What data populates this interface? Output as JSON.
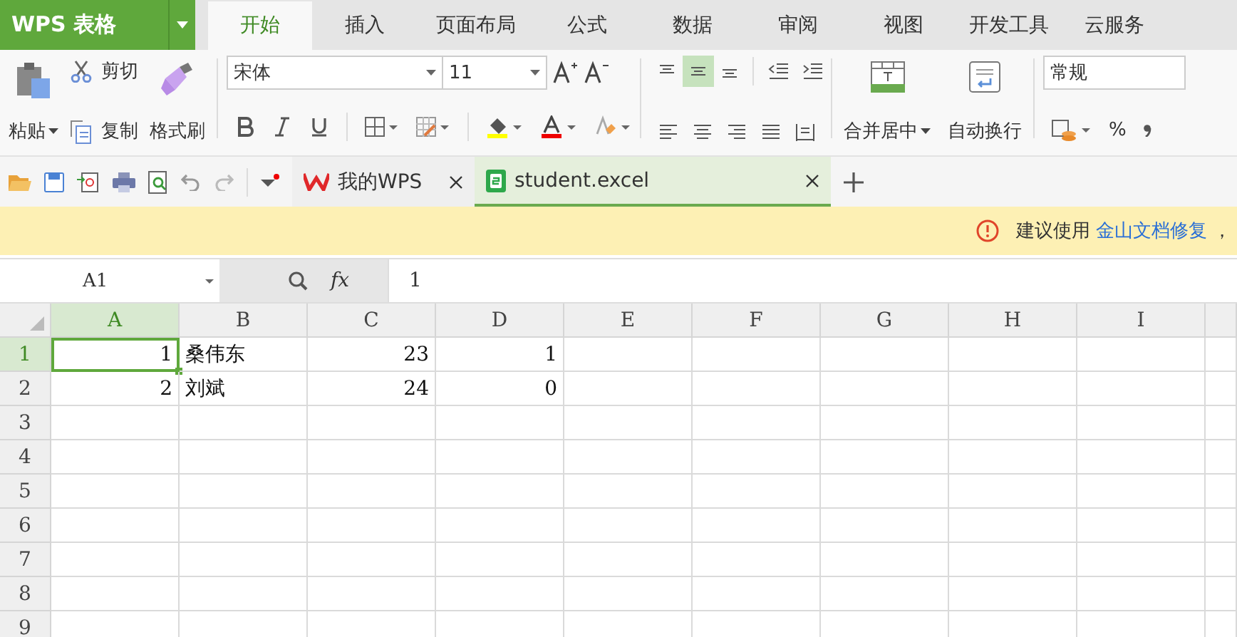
{
  "app": {
    "name": "WPS 表格"
  },
  "menu_tabs": [
    {
      "label": "开始",
      "selected": true
    },
    {
      "label": "插入",
      "selected": false
    },
    {
      "label": "页面布局",
      "selected": false
    },
    {
      "label": "公式",
      "selected": false
    },
    {
      "label": "数据",
      "selected": false
    },
    {
      "label": "审阅",
      "selected": false
    },
    {
      "label": "视图",
      "selected": false
    },
    {
      "label": "开发工具",
      "selected": false
    },
    {
      "label": "云服务",
      "selected": false
    }
  ],
  "ribbon": {
    "paste": "粘贴",
    "cut": "剪切",
    "copy": "复制",
    "format_painter": "格式刷",
    "font_name": "宋体",
    "font_size": "11",
    "merge": "合并居中",
    "wrap": "自动换行",
    "number_format": "常规",
    "percent": "%",
    "align_top": [
      {
        "kind": "top",
        "selected": false
      },
      {
        "kind": "middle",
        "selected": true
      },
      {
        "kind": "bottom",
        "selected": false
      }
    ]
  },
  "doc_tabs": [
    {
      "label": "我的WPS",
      "kind": "wps",
      "selected": false
    },
    {
      "label": "student.excel",
      "kind": "sheet",
      "selected": true
    }
  ],
  "notice": {
    "text": "建议使用",
    "link": "金山文档修复",
    "tail": "，"
  },
  "formula_bar": {
    "cell_ref": "A1",
    "fx": "fx",
    "value": "1"
  },
  "sheet": {
    "columns": [
      {
        "label": "A",
        "selected": true
      },
      {
        "label": "B",
        "selected": false
      },
      {
        "label": "C",
        "selected": false
      },
      {
        "label": "D",
        "selected": false
      },
      {
        "label": "E",
        "selected": false
      },
      {
        "label": "F",
        "selected": false
      },
      {
        "label": "G",
        "selected": false
      },
      {
        "label": "H",
        "selected": false
      },
      {
        "label": "I",
        "selected": false
      }
    ],
    "rows": [
      {
        "label": "1",
        "selected": true,
        "cells": [
          {
            "value": "1",
            "kind": "number",
            "selected": true
          },
          {
            "value": "桑伟东",
            "kind": "text",
            "selected": false
          },
          {
            "value": "23",
            "kind": "number",
            "selected": false
          },
          {
            "value": "1",
            "kind": "number",
            "selected": false
          }
        ]
      },
      {
        "label": "2",
        "selected": false,
        "cells": [
          {
            "value": "2",
            "kind": "number",
            "selected": false
          },
          {
            "value": "刘斌",
            "kind": "text",
            "selected": false
          },
          {
            "value": "24",
            "kind": "number",
            "selected": false
          },
          {
            "value": "0",
            "kind": "number",
            "selected": false
          }
        ]
      },
      {
        "label": "3",
        "selected": false,
        "cells": []
      },
      {
        "label": "4",
        "selected": false,
        "cells": []
      },
      {
        "label": "5",
        "selected": false,
        "cells": []
      },
      {
        "label": "6",
        "selected": false,
        "cells": []
      },
      {
        "label": "7",
        "selected": false,
        "cells": []
      },
      {
        "label": "8",
        "selected": false,
        "cells": []
      },
      {
        "label": "9",
        "selected": false,
        "cells": []
      }
    ]
  }
}
